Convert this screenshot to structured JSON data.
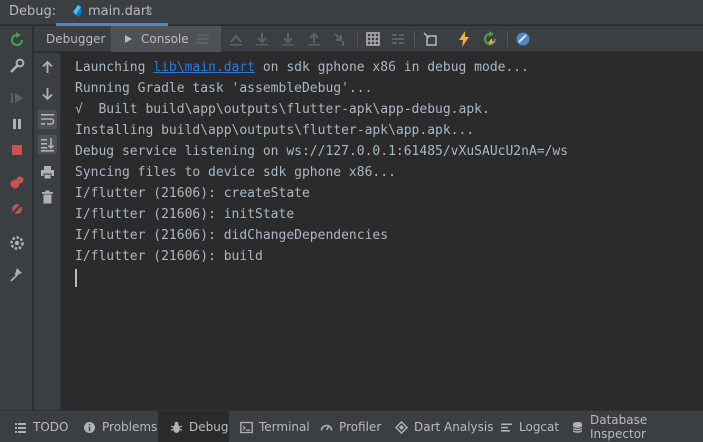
{
  "header": {
    "debug_label": "Debug:",
    "file_tab": "main.dart",
    "close_glyph": "×"
  },
  "toolbar": {
    "debugger_tab": "Debugger",
    "console_tab": "Console"
  },
  "console": {
    "lines": [
      {
        "prefix": "Launching ",
        "link": "lib\\main.dart",
        "suffix": " on sdk gphone x86 in debug mode..."
      },
      {
        "text": "Running Gradle task 'assembleDebug'..."
      },
      {
        "text": "√  Built build\\app\\outputs\\flutter-apk\\app-debug.apk."
      },
      {
        "text": "Installing build\\app\\outputs\\flutter-apk\\app.apk..."
      },
      {
        "text": "Debug service listening on ws://127.0.0.1:61485/vXuSAUcU2nA=/ws"
      },
      {
        "text": "Syncing files to device sdk gphone x86..."
      },
      {
        "text": "I/flutter (21606): createState"
      },
      {
        "text": "I/flutter (21606): initState"
      },
      {
        "text": "I/flutter (21606): didChangeDependencies"
      },
      {
        "text": "I/flutter (21606): build"
      }
    ]
  },
  "bottom_bar": {
    "items": [
      {
        "label": "TODO",
        "icon": "list-icon"
      },
      {
        "label": "Problems",
        "icon": "info-icon"
      },
      {
        "label": "Debug",
        "icon": "bug-icon"
      },
      {
        "label": "Terminal",
        "icon": "terminal-icon"
      },
      {
        "label": "Profiler",
        "icon": "gauge-icon"
      },
      {
        "label": "Dart Analysis",
        "icon": "dart-icon"
      },
      {
        "label": "Logcat",
        "icon": "logcat-icon"
      },
      {
        "label": "Database Inspector",
        "icon": "database-icon"
      }
    ]
  },
  "colors": {
    "background": "#2b2b2b",
    "panel": "#3c3f41",
    "text": "#a9b7c6",
    "link": "#287bde",
    "accent_tab": "#4a88c7",
    "rerun_green": "#499c54",
    "stop_red": "#c75450",
    "lightning_yellow": "#f4af3d"
  }
}
